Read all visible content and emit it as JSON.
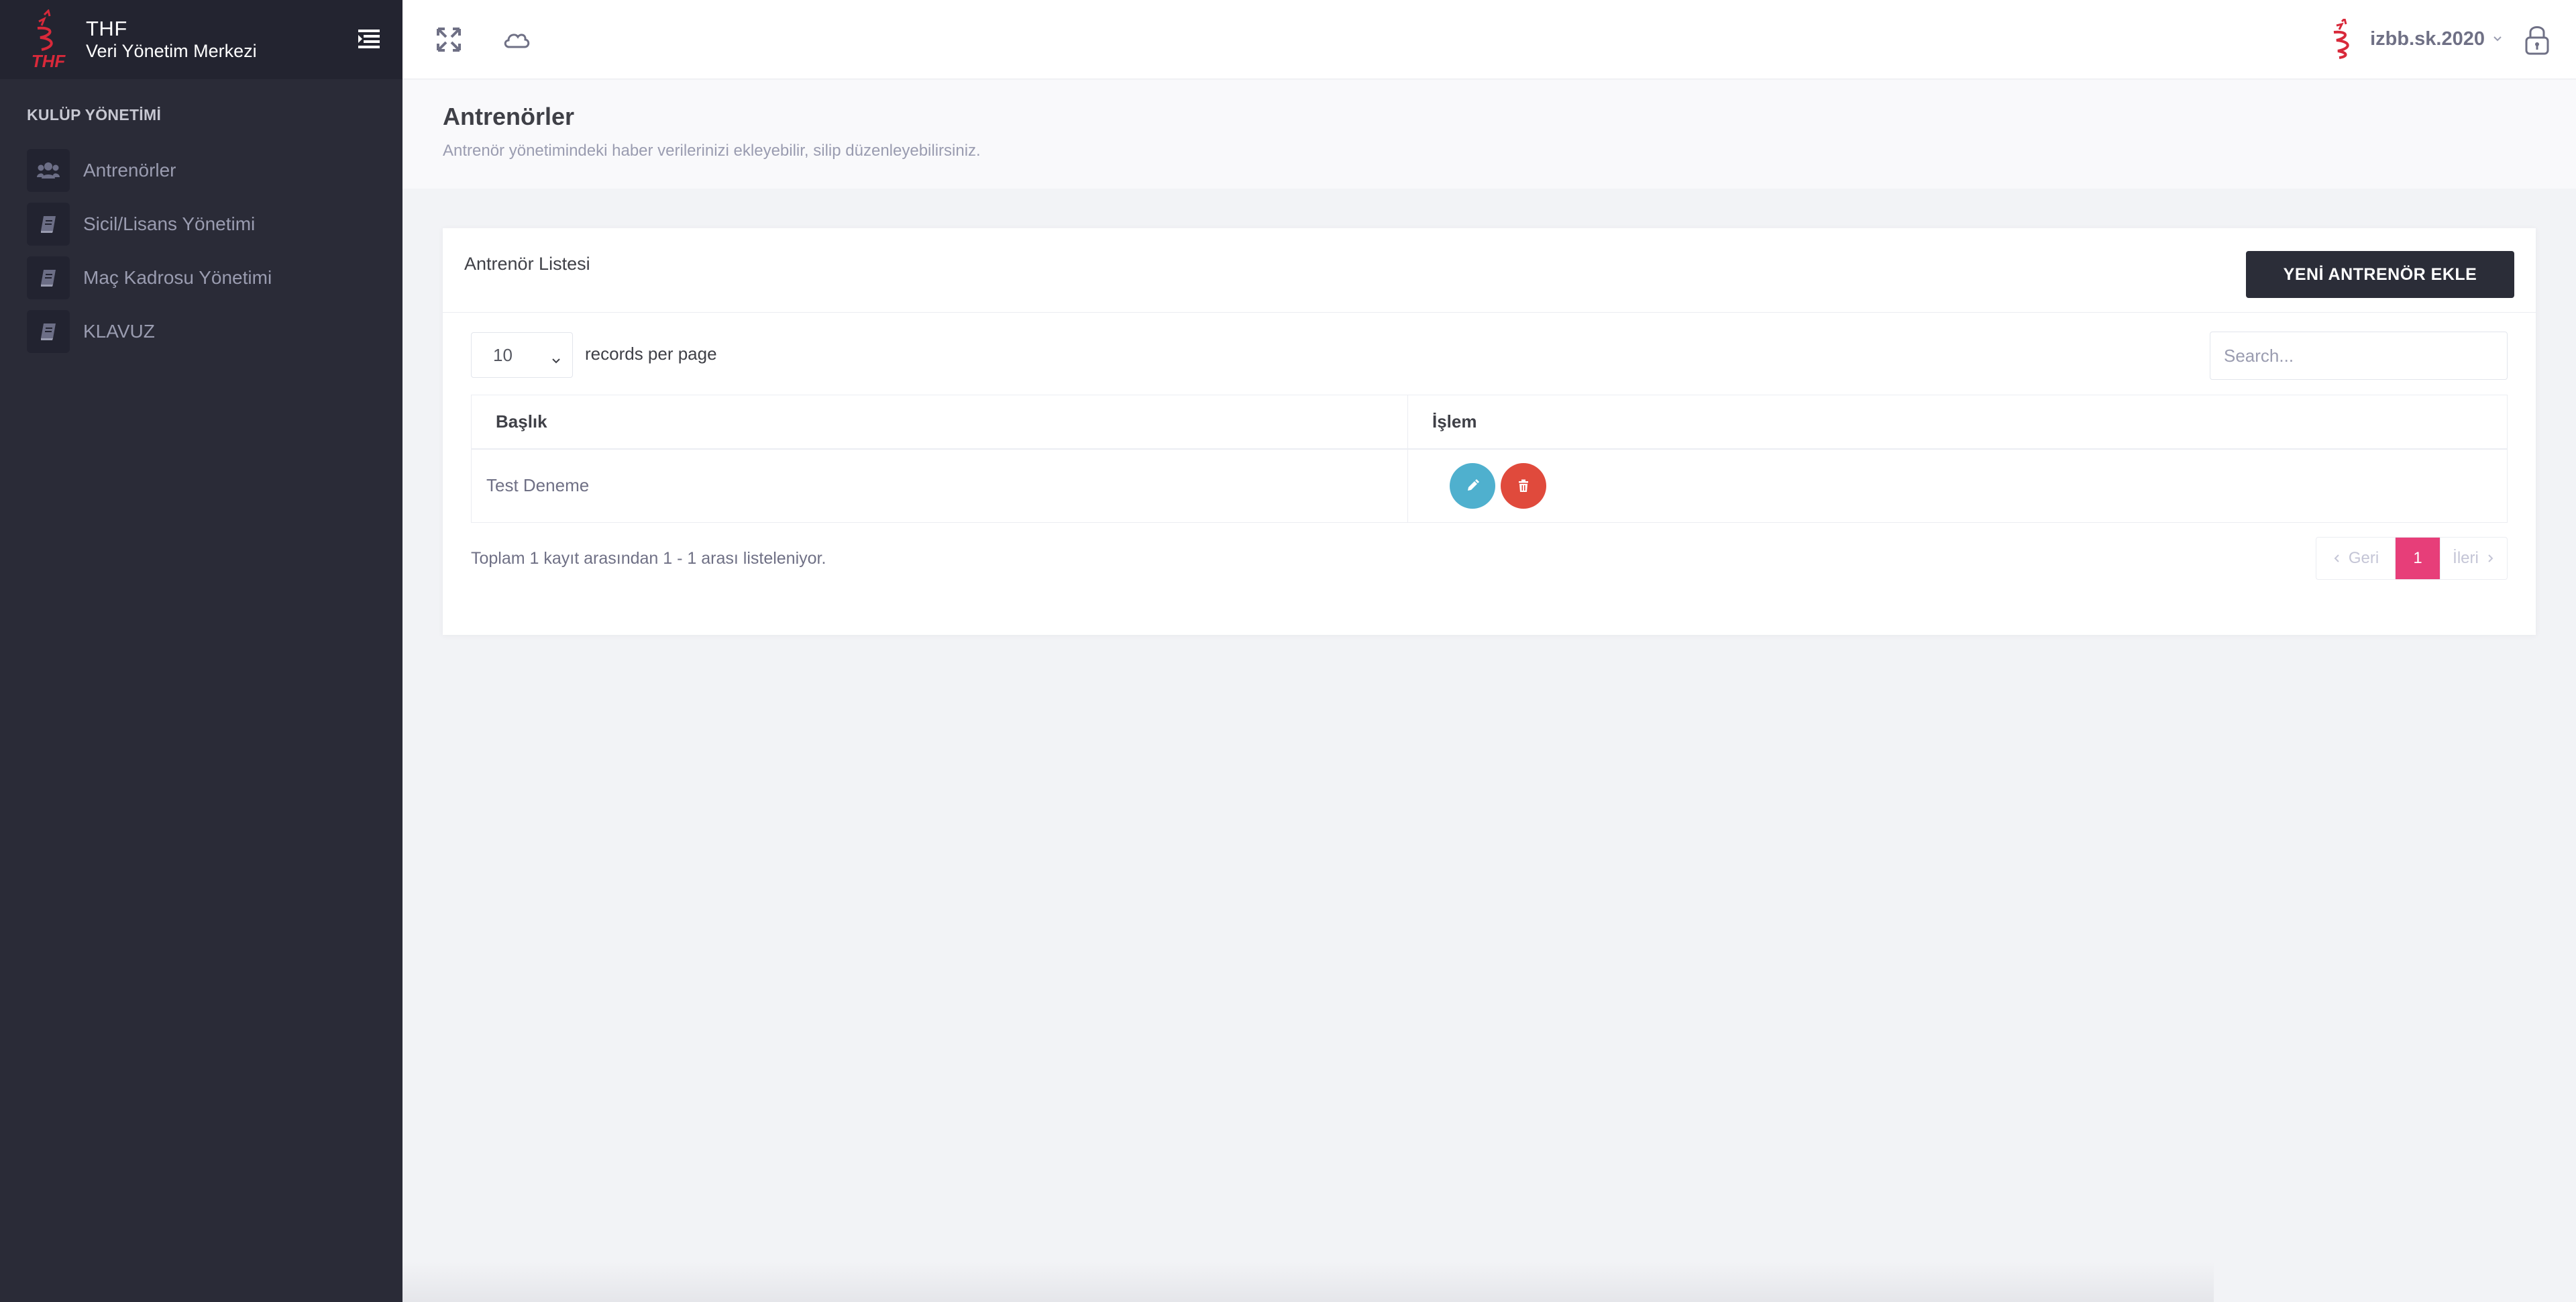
{
  "brand": {
    "title": "THF",
    "subtitle": "Veri Yönetim Merkezi",
    "logo_text": "THF"
  },
  "sidebar": {
    "section_title": "KULÜP YÖNETİMİ",
    "items": [
      {
        "label": "Antrenörler",
        "icon": "users-icon"
      },
      {
        "label": "Sicil/Lisans Yönetimi",
        "icon": "book-icon"
      },
      {
        "label": "Maç Kadrosu Yönetimi",
        "icon": "book-icon"
      },
      {
        "label": "KLAVUZ",
        "icon": "book-icon"
      }
    ]
  },
  "header": {
    "icons": [
      "fullscreen-icon",
      "cloud-icon"
    ],
    "username": "izbb.sk.2020",
    "lock_icon": "lock-icon"
  },
  "page": {
    "title": "Antrenörler",
    "description": "Antrenör yönetimindeki haber verilerinizi ekleyebilir, silip düzenleyebilirsiniz."
  },
  "portlet": {
    "title": "Antrenör Listesi",
    "add_button": "YENİ ANTRENÖR EKLE",
    "page_length": "10",
    "page_length_label": "records per page",
    "search_placeholder": "Search...",
    "columns": [
      "Başlık",
      "İşlem"
    ],
    "rows": [
      {
        "title": "Test Deneme"
      }
    ],
    "info": "Toplam 1 kayıt arasından 1 - 1 arası listeleniyor.",
    "pager": {
      "prev": "Geri",
      "current": "1",
      "next": "İleri"
    }
  },
  "colors": {
    "sidebar_bg": "#2a2b37",
    "accent_pink": "#e73e79",
    "edit_button": "#4fb0ce",
    "delete_button": "#e04a3c",
    "primary_dark": "#2b2d38"
  }
}
